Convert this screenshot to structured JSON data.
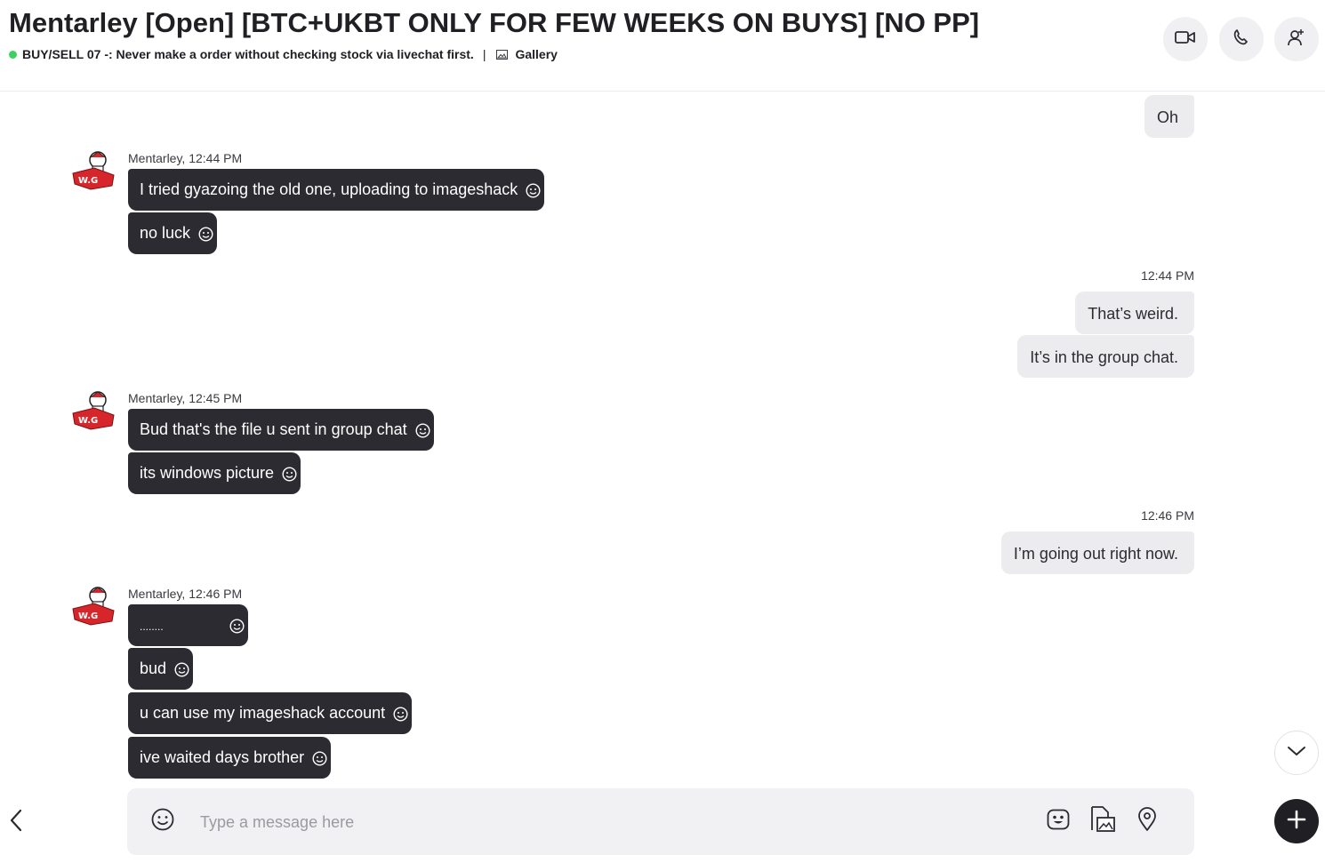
{
  "header": {
    "title": "Mentarley [Open] [BTC+UKBT ONLY FOR FEW WEEKS ON BUYS] [NO PP]",
    "status_text": "BUY/SELL 07 -: Never make a order without checking stock via livechat first.",
    "separator": "|",
    "gallery_label": "Gallery",
    "status_color": "#3ed162",
    "buttons": [
      "video-call-icon",
      "audio-call-icon",
      "add-person-icon"
    ]
  },
  "messages": {
    "out_1": {
      "text": "Oh"
    },
    "group_1": {
      "sender": "Mentarley, 12:44 PM",
      "bubbles": [
        "I tried gyazoing the old one, uploading to imageshack",
        "no luck"
      ]
    },
    "out_2": {
      "time": "12:44 PM",
      "bubbles": [
        "That’s weird.",
        "It’s in the group chat."
      ]
    },
    "group_2": {
      "sender": "Mentarley, 12:45 PM",
      "bubbles": [
        "Bud that's the file u sent in group chat",
        "its windows picture"
      ]
    },
    "out_3": {
      "time": "12:46 PM",
      "bubbles": [
        "I’m going out right now."
      ]
    },
    "group_3": {
      "sender": "Mentarley, 12:46 PM",
      "bubbles": [
        "........",
        "bud",
        "u can use my imageshack account",
        "ive waited days brother"
      ]
    }
  },
  "composer": {
    "placeholder": "Type a message here",
    "value": "",
    "icons": [
      "emoji-icon",
      "sticker-icon",
      "media-icon",
      "location-icon",
      "plus-icon"
    ]
  },
  "colors": {
    "incoming_bubble": "#2b2b31",
    "outgoing_bubble": "#ececee",
    "avatar_red": "#d6262b"
  }
}
